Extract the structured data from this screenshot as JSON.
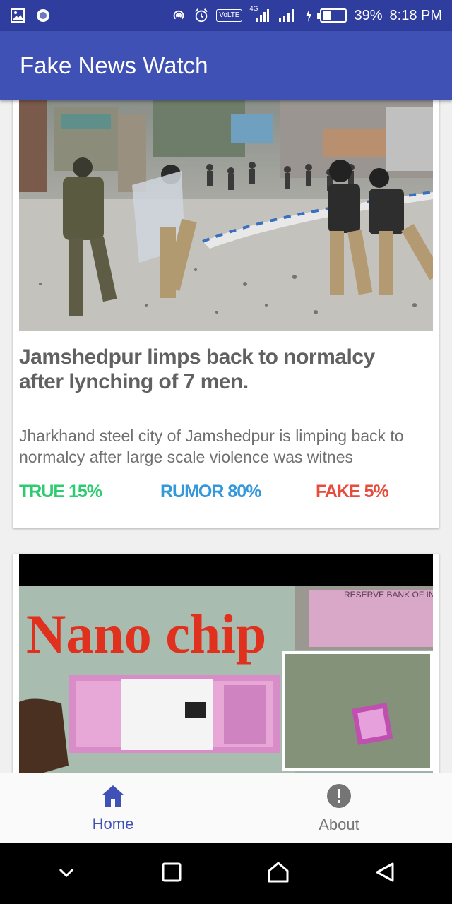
{
  "status_bar": {
    "network": "4G",
    "volte": "VoLTE",
    "battery": "39%",
    "time": "8:18 PM"
  },
  "app_bar": {
    "title": "Fake News Watch"
  },
  "articles": [
    {
      "image": "riot-police-photo",
      "title": "Jamshedpur limps back to normalcy after lynching of 7 men.",
      "description": "Jharkhand steel city of Jamshedpur is limping back to normalcy after large scale violence was witnes",
      "true_label": "TRUE 15%",
      "rumor_label": "RUMOR 80%",
      "fake_label": "FAKE 5%",
      "true": 15,
      "rumor": 80,
      "fake": 5
    },
    {
      "image": "nano-chip-banknote-photo",
      "image_text": "Nano chip",
      "note_text": "RESERVE BANK OF INDIA"
    }
  ],
  "colors": {
    "true": "#2ecc71",
    "rumor": "#3498db",
    "fake": "#e74c3c",
    "primary": "#3f51b5"
  },
  "bottom_nav": {
    "items": [
      {
        "label": "Home",
        "icon": "home-icon",
        "active": true
      },
      {
        "label": "About",
        "icon": "info-exclamation-icon",
        "active": false
      }
    ]
  }
}
